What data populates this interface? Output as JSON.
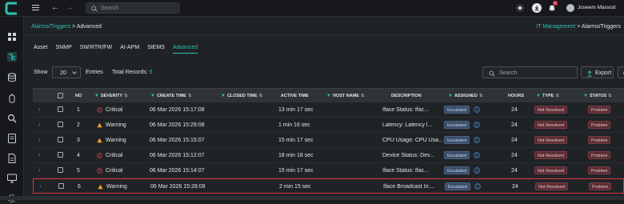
{
  "topbar": {
    "search_placeholder": "Search",
    "notification_count": "1",
    "user_name": "Joseem Massod"
  },
  "breadcrumb": {
    "section": "Alarms/Triggers",
    "separator": " > ",
    "current": "Advanced",
    "right_section": "IT Management",
    "right_separator": " > ",
    "right_current": "Alarms/Triggers"
  },
  "tabs": [
    {
      "label": "Asset"
    },
    {
      "label": "SNMP"
    },
    {
      "label": "SW/RTR/FW"
    },
    {
      "label": "AI-APM"
    },
    {
      "label": "SIEMS"
    },
    {
      "label": "Advanced"
    }
  ],
  "controls": {
    "show_label": "Show",
    "page_size": "20",
    "entries_label": "Entries",
    "total_label": "Total Records:",
    "total_value": "6",
    "search_placeholder": "Search",
    "export_label": "Export"
  },
  "table": {
    "headers": {
      "no": "NO",
      "severity": "SEVERITY",
      "create_time": "CREATE TIME",
      "closed_time": "CLOSED TIME",
      "active_time": "ACTIVE TIME",
      "host_name": "HOST NAME",
      "description": "DESCRIPTION",
      "assigned": "ASSIGNED",
      "hours": "HOURS",
      "type": "TYPE",
      "status": "STATUS"
    },
    "rows": [
      {
        "no": "1",
        "severity": "Critical",
        "sev_kind": "critical",
        "create_time": "06 Mar 2026 15:17:08",
        "active_time": "13 min 17 sec",
        "description": "Iface Status: Ifac...",
        "assigned": "Escalated",
        "hours": "24",
        "type": "Not Resolved",
        "status": "Problem"
      },
      {
        "no": "2",
        "severity": "Warning",
        "sev_kind": "warning",
        "create_time": "06 Mar 2026 15:29:08",
        "active_time": "1 min 16 sec",
        "description": "Latency: Latency l...",
        "assigned": "Escalated",
        "hours": "24",
        "type": "Not Resolved",
        "status": "Problem"
      },
      {
        "no": "3",
        "severity": "Warning",
        "sev_kind": "warning",
        "create_time": "06 Mar 2026 15:15:07",
        "active_time": "15 min 17 sec",
        "description": "CPU Usage: CPU Usa...",
        "assigned": "Escalated",
        "hours": "24",
        "type": "Not Resolved",
        "status": "Problem"
      },
      {
        "no": "4",
        "severity": "Critical",
        "sev_kind": "critical",
        "create_time": "06 Mar 2026 15:12:07",
        "active_time": "18 min 18 sec",
        "description": "Device Status: Dev...",
        "assigned": "Escalated",
        "hours": "24",
        "type": "Not Resolved",
        "status": "Problem"
      },
      {
        "no": "5",
        "severity": "Critical",
        "sev_kind": "critical",
        "create_time": "06 Mar 2026 15:14:07",
        "active_time": "15 min 17 sec",
        "description": "Iface Status: Ifac...",
        "assigned": "Escalated",
        "hours": "24",
        "type": "Not Resolved",
        "status": "Problem"
      },
      {
        "no": "6",
        "severity": "Warning",
        "sev_kind": "warning",
        "create_time": "06 Mar 2026 15:28:09",
        "active_time": "2 min 15 sec",
        "description": "Iface Broadcast In:...",
        "assigned": "Escalated",
        "hours": "24",
        "type": "Not Resolved",
        "status": "Problem"
      }
    ]
  },
  "colors": {
    "accent": "#2fbfb0",
    "critical": "#e0344a",
    "warning": "#f0a020",
    "highlight_border": "#d9313c"
  }
}
